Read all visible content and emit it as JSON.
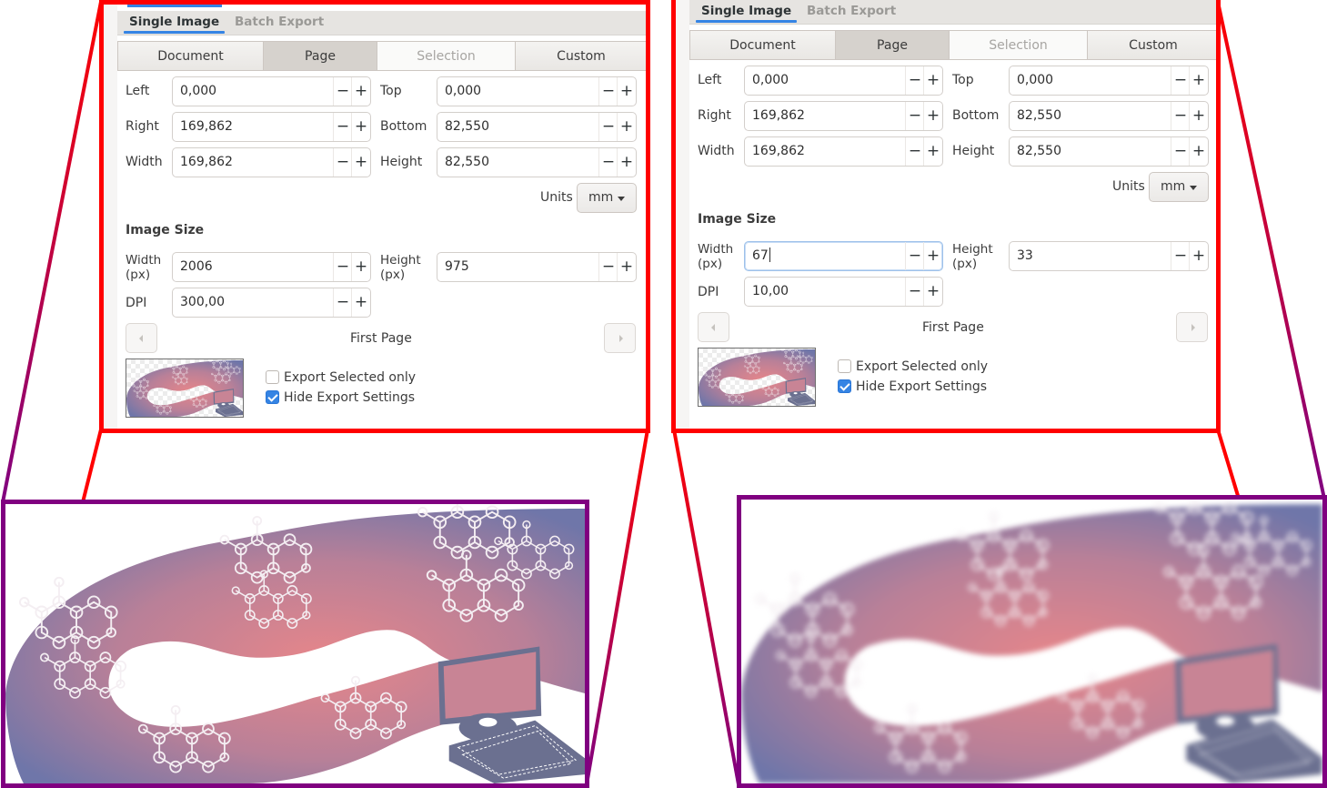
{
  "panels": [
    {
      "id": "left",
      "tabs": [
        {
          "label": "Single Image",
          "active": true
        },
        {
          "label": "Batch Export",
          "active": false
        }
      ],
      "area_buttons": [
        {
          "label": "Document",
          "state": "normal"
        },
        {
          "label": "Page",
          "state": "active"
        },
        {
          "label": "Selection",
          "state": "disabled"
        },
        {
          "label": "Custom",
          "state": "normal"
        }
      ],
      "area_fields": {
        "left": {
          "label": "Left",
          "value": "0,000"
        },
        "top": {
          "label": "Top",
          "value": "0,000"
        },
        "right": {
          "label": "Right",
          "value": "169,862"
        },
        "bottom": {
          "label": "Bottom",
          "value": "82,550"
        },
        "width": {
          "label": "Width",
          "value": "169,862"
        },
        "height": {
          "label": "Height",
          "value": "82,550"
        }
      },
      "units": {
        "label": "Units",
        "value": "mm"
      },
      "image_size": {
        "title": "Image Size",
        "width": {
          "label_line1": "Width",
          "label_line2": "(px)",
          "value": "2006",
          "focused": false
        },
        "height": {
          "label_line1": "Height",
          "label_line2": "(px)",
          "value": "975"
        },
        "dpi": {
          "label": "DPI",
          "value": "300,00"
        }
      },
      "page_nav": {
        "label": "First Page",
        "prev_icon": "chevron-left-icon",
        "next_icon": "chevron-right-icon"
      },
      "checkboxes": [
        {
          "label": "Export Selected only",
          "checked": false
        },
        {
          "label": "Hide Export Settings",
          "checked": true
        }
      ],
      "spin_minus": "−",
      "spin_plus": "+"
    },
    {
      "id": "right",
      "tabs": [
        {
          "label": "Single Image",
          "active": true
        },
        {
          "label": "Batch Export",
          "active": false
        }
      ],
      "area_buttons": [
        {
          "label": "Document",
          "state": "normal"
        },
        {
          "label": "Page",
          "state": "active"
        },
        {
          "label": "Selection",
          "state": "disabled"
        },
        {
          "label": "Custom",
          "state": "normal"
        }
      ],
      "area_fields": {
        "left": {
          "label": "Left",
          "value": "0,000"
        },
        "top": {
          "label": "Top",
          "value": "0,000"
        },
        "right": {
          "label": "Right",
          "value": "169,862"
        },
        "bottom": {
          "label": "Bottom",
          "value": "82,550"
        },
        "width": {
          "label": "Width",
          "value": "169,862"
        },
        "height": {
          "label": "Height",
          "value": "82,550"
        }
      },
      "units": {
        "label": "Units",
        "value": "mm"
      },
      "image_size": {
        "title": "Image Size",
        "width": {
          "label_line1": "Width",
          "label_line2": "(px)",
          "value": "67",
          "focused": true
        },
        "height": {
          "label_line1": "Height",
          "label_line2": "(px)",
          "value": "33"
        },
        "dpi": {
          "label": "DPI",
          "value": "10,00"
        }
      },
      "page_nav": {
        "label": "First Page",
        "prev_icon": "chevron-left-icon",
        "next_icon": "chevron-right-icon"
      },
      "checkboxes": [
        {
          "label": "Export Selected only",
          "checked": false
        },
        {
          "label": "Hide Export Settings",
          "checked": true
        }
      ],
      "spin_minus": "−",
      "spin_plus": "+"
    }
  ],
  "illustrations": [
    {
      "id": "left",
      "description": "high-resolution export preview: gradient ribbon with molecule drawings and a computer",
      "quality": "sharp"
    },
    {
      "id": "right",
      "description": "low-resolution export preview of same artwork",
      "quality": "pixelated"
    }
  ],
  "colors": {
    "zoom_frame_top": "#ff0000",
    "zoom_frame_bottom": "#800080",
    "accent": "#3584e4",
    "ribbon_pink": "#e0848a",
    "ribbon_purple": "#7a74a8",
    "computer_gray": "#6b7090"
  }
}
